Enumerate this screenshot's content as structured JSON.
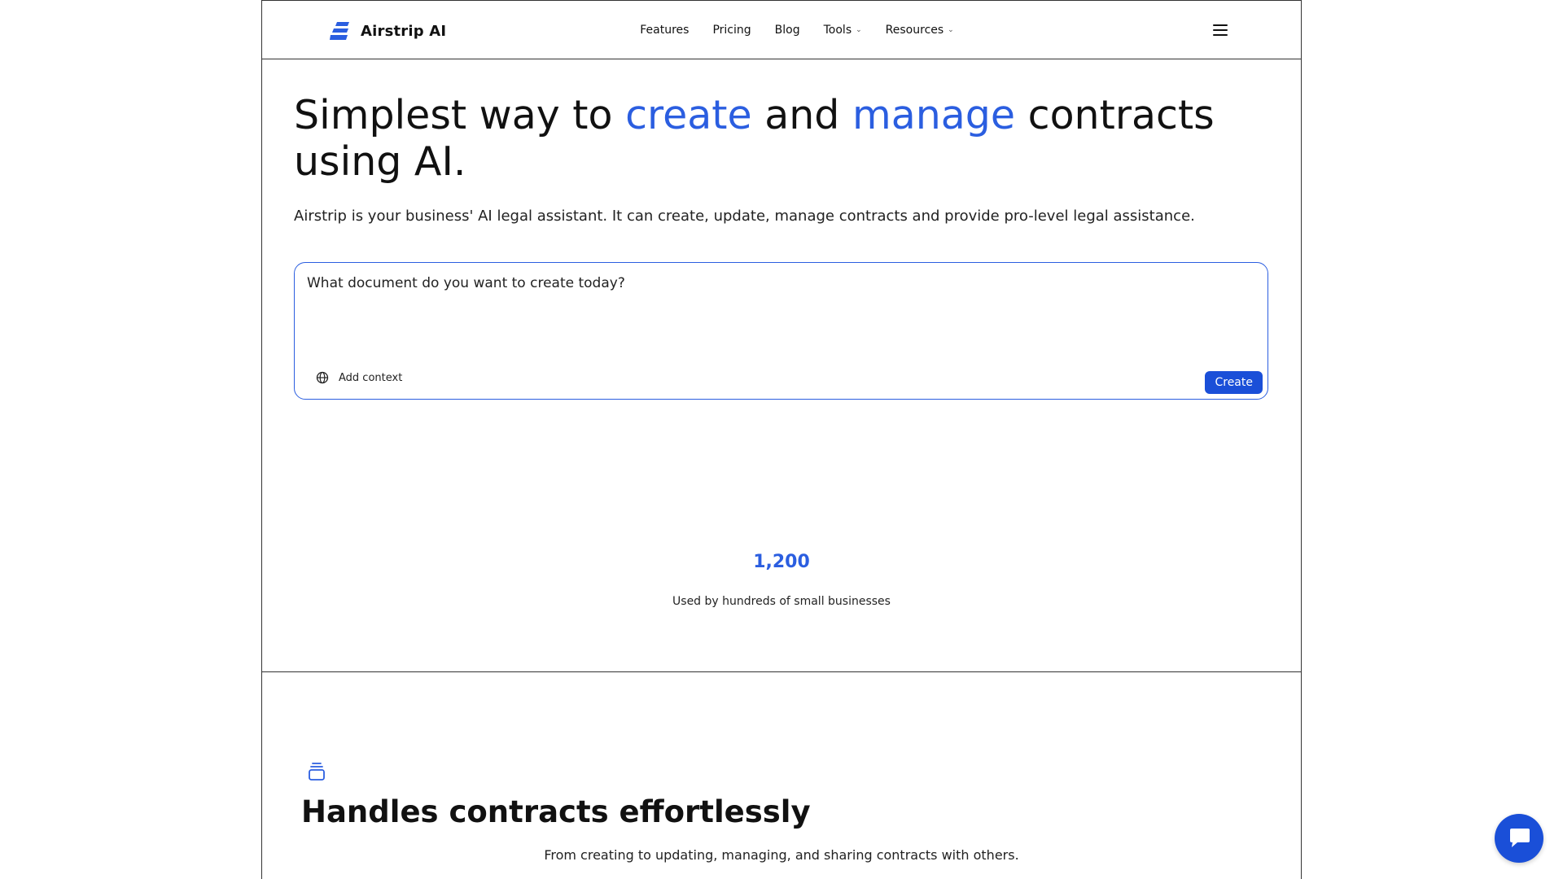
{
  "brand": {
    "name": "Airstrip AI",
    "color": "#2b5ee0"
  },
  "nav": {
    "items": [
      {
        "label": "Features"
      },
      {
        "label": "Pricing"
      },
      {
        "label": "Blog"
      },
      {
        "label": "Tools",
        "dropdown": true
      },
      {
        "label": "Resources",
        "dropdown": true
      }
    ],
    "menu_icon": "hamburger-menu-icon"
  },
  "hero": {
    "headline_1": "Simplest way to ",
    "headline_accent_1": "create",
    "headline_2": " and ",
    "headline_accent_2": "manage",
    "headline_3": " contracts using AI.",
    "subtitle": "Airstrip is your business' AI legal assistant. It can create, update, manage contracts and provide pro-level legal assistance.",
    "prompt": {
      "placeholder": "What document do you want to create today?",
      "add_context_label": "Add context",
      "add_context_icon": "globe-icon",
      "create_label": "Create"
    },
    "stat": {
      "value": "1,200",
      "label": "Used by hundreds of small businesses"
    }
  },
  "features": {
    "icon": "stack-icon",
    "title": "Handles contracts effortlessly",
    "subtitle": "From creating to updating, managing, and sharing contracts with others."
  },
  "chat": {
    "icon": "chat-bubble-icon"
  }
}
